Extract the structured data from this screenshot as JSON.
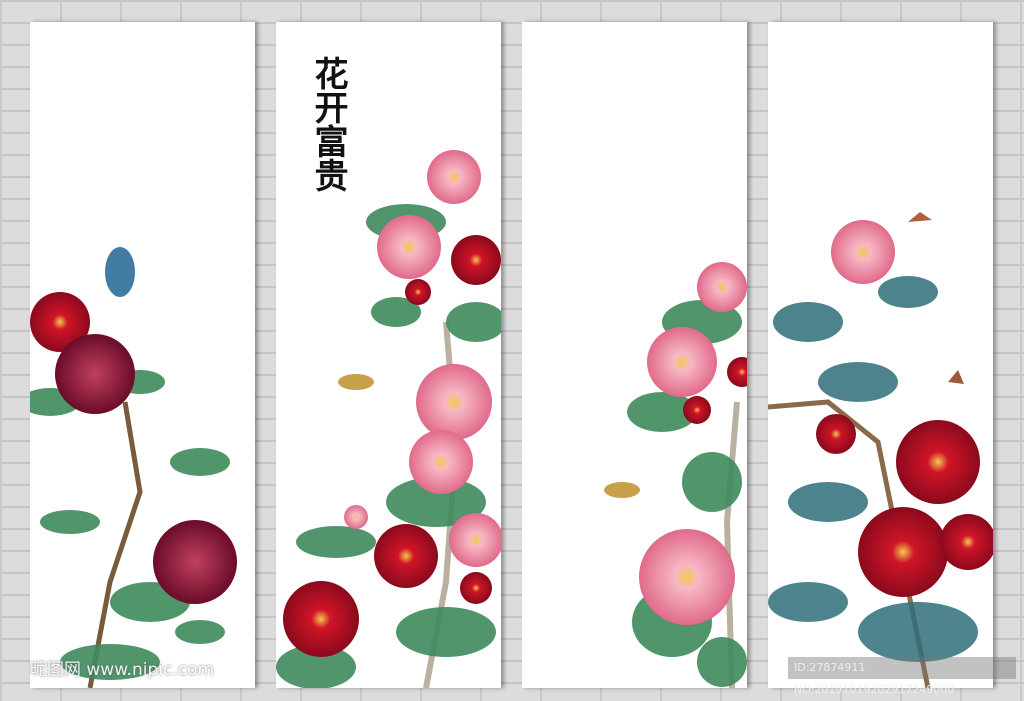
{
  "artwork": {
    "title": "花开富贵",
    "panel_count": 4
  },
  "watermark": {
    "site": "昵图网 www.nipic.com",
    "id_text": "ID:27874911 NO:20191019202917249000"
  },
  "colors": {
    "wall": "#dcdcdc",
    "panel": "#ffffff",
    "peony_red": "#c8102e",
    "peony_pink": "#f4a6b8",
    "leaf": "#3f8a5c"
  }
}
